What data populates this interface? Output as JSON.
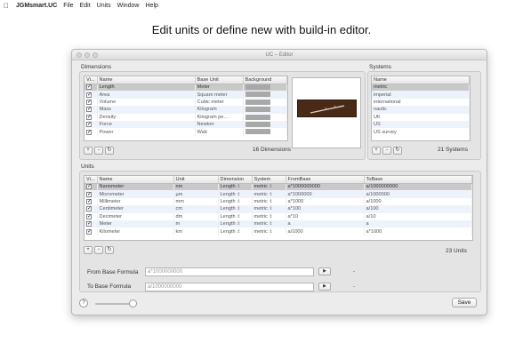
{
  "menubar": {
    "app_name": "JGMsmart.UC",
    "items": [
      "File",
      "Edit",
      "Units",
      "Window",
      "Help"
    ]
  },
  "headline": "Edit units or define new with build-in editor.",
  "window": {
    "title": "UC – Editor",
    "dimensions": {
      "section_label": "Dimensions",
      "columns": [
        "Vi...",
        "Name",
        "Base Unit",
        "Background"
      ],
      "rows": [
        {
          "name": "Length",
          "base_unit": "Meter"
        },
        {
          "name": "Area",
          "base_unit": "Square meter"
        },
        {
          "name": "Volume",
          "base_unit": "Cubic meter"
        },
        {
          "name": "Mass",
          "base_unit": "Kilogram"
        },
        {
          "name": "Density",
          "base_unit": "Kilogram pe..."
        },
        {
          "name": "Force",
          "base_unit": "Newton"
        },
        {
          "name": "Power",
          "base_unit": "Watt"
        }
      ],
      "count_label": "16 Dimensions"
    },
    "systems": {
      "section_label": "Systems",
      "columns": [
        "Name"
      ],
      "rows": [
        "metric",
        "imperial",
        "international",
        "nautic",
        "UK",
        "US",
        "US survey"
      ],
      "count_label": "21 Systems"
    },
    "units": {
      "section_label": "Units",
      "columns": [
        "Vi...",
        "Name",
        "Unit",
        "Dimension",
        "System",
        "FromBase",
        "ToBase"
      ],
      "rows": [
        {
          "name": "Nanometer",
          "unit": "nm",
          "dimension": "Length",
          "system": "metric",
          "from_base": "a*1000000000",
          "to_base": "a/1000000000"
        },
        {
          "name": "Micrometer",
          "unit": "µm",
          "dimension": "Length",
          "system": "metric",
          "from_base": "a*1000000",
          "to_base": "a/1000000"
        },
        {
          "name": "Millimeter",
          "unit": "mm",
          "dimension": "Length",
          "system": "metric",
          "from_base": "a*1000",
          "to_base": "a/1000"
        },
        {
          "name": "Centimeter",
          "unit": "cm",
          "dimension": "Length",
          "system": "metric",
          "from_base": "a*100",
          "to_base": "a/100"
        },
        {
          "name": "Decimeter",
          "unit": "dm",
          "dimension": "Length",
          "system": "metric",
          "from_base": "a*10",
          "to_base": "a/10"
        },
        {
          "name": "Meter",
          "unit": "m",
          "dimension": "Length",
          "system": "metric",
          "from_base": "a",
          "to_base": "a"
        },
        {
          "name": "Kilometer",
          "unit": "km",
          "dimension": "Length",
          "system": "metric",
          "from_base": "a/1000",
          "to_base": "a*1000"
        }
      ],
      "count_label": "23 Units"
    },
    "buttons": {
      "add": "+",
      "remove": "−",
      "refresh": "↻"
    },
    "formulas": {
      "from_label": "From Base Formula",
      "from_value": "a*1000000000",
      "from_result": "-",
      "to_label": "To Base Formula",
      "to_value": "a/1000000000",
      "to_result": "-",
      "play": "▶"
    },
    "help": "?",
    "save_label": "Save",
    "slider_level": 0.9
  },
  "colors": {
    "selection": "#c9c9c9",
    "alt_row": "#eef3fb",
    "swatch": "#a8a8a8",
    "preview_bg": "#4a2a17"
  }
}
